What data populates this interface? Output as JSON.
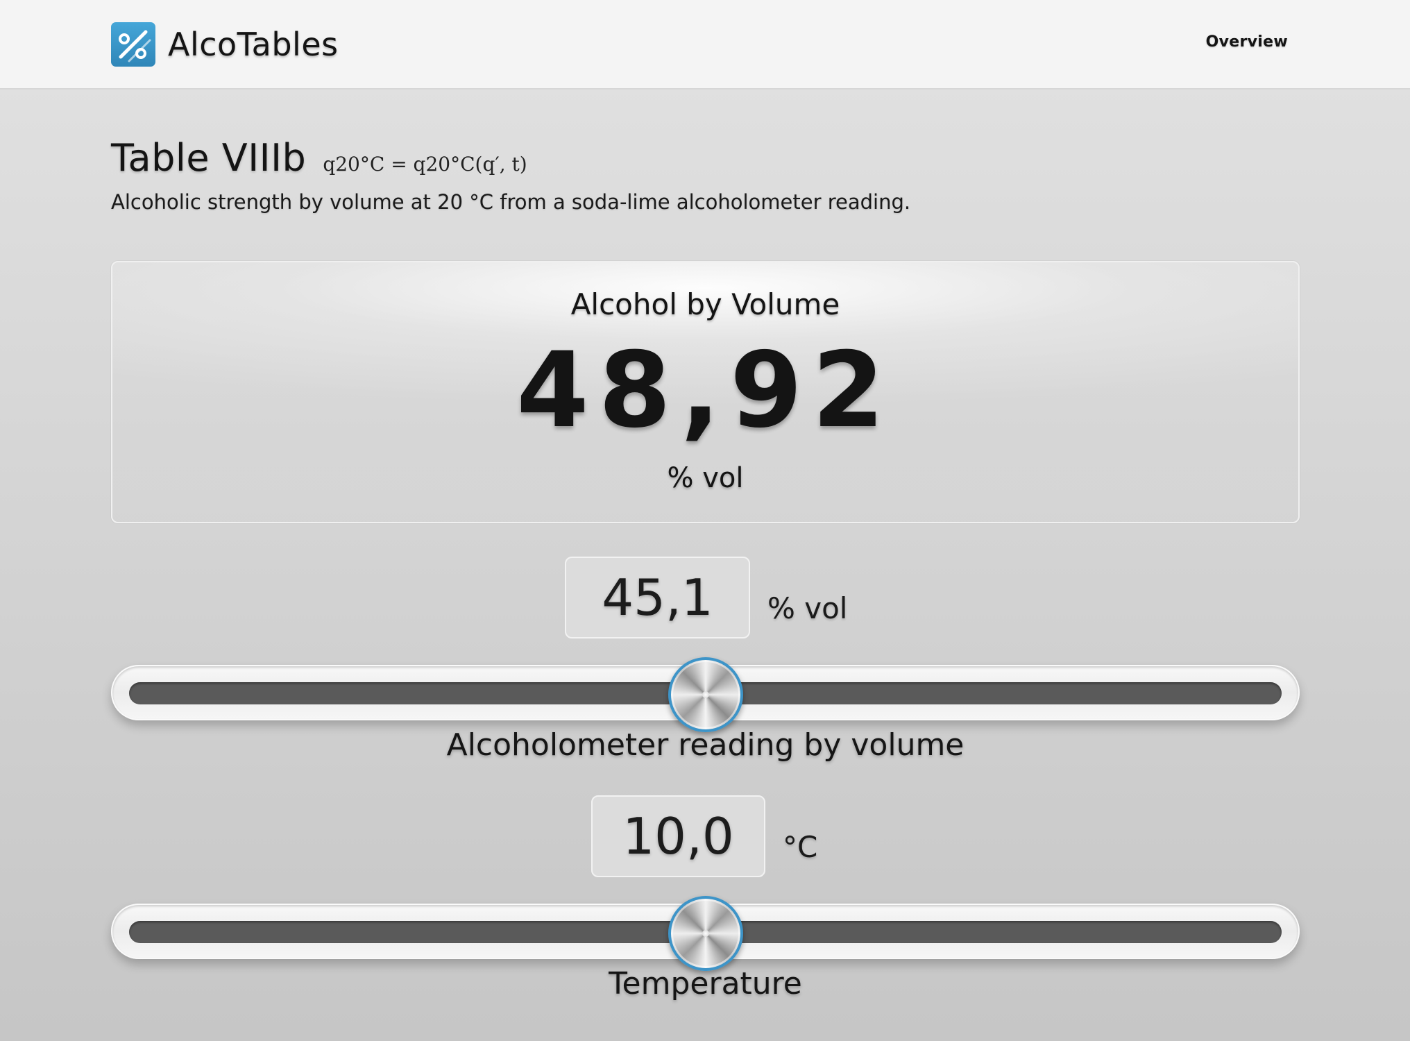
{
  "header": {
    "app_name": "AlcoTables",
    "logo_icon": "percent-logo-icon",
    "nav": {
      "overview_label": "Overview"
    },
    "accent_color": "#3d94c8"
  },
  "page": {
    "title": "Table VIIIb",
    "formula": "q20°C = q20°C(q′, t)",
    "description": "Alcoholic strength by volume at 20 °C from a soda-lime alcoholometer reading."
  },
  "result": {
    "label": "Alcohol by Volume",
    "value": "48,92",
    "unit": "% vol"
  },
  "alcoholometer": {
    "value": "45,1",
    "unit": "% vol",
    "caption": "Alcoholometer reading by volume",
    "slider_position": 0.5
  },
  "temperature": {
    "value": "10,0",
    "unit": "°C",
    "caption": "Temperature",
    "slider_position": 0.5
  }
}
